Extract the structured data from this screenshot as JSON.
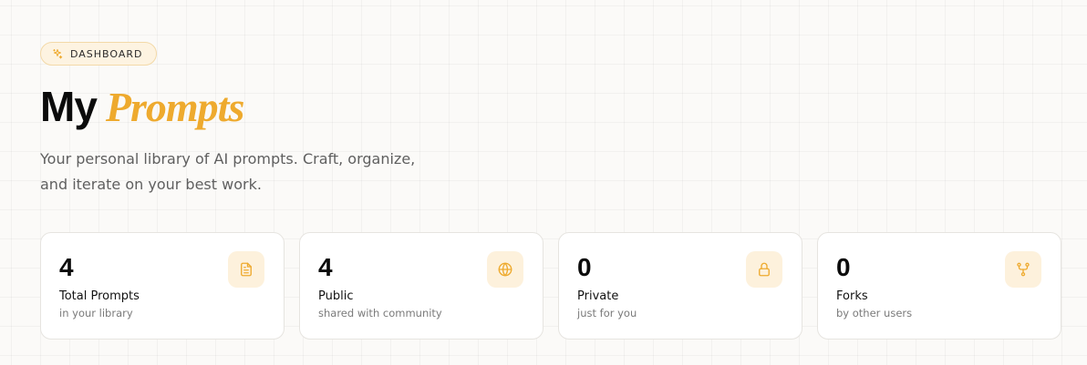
{
  "badge": {
    "label": "DASHBOARD",
    "icon": "sparkles-icon"
  },
  "header": {
    "title_main": "My",
    "title_accent": "Prompts"
  },
  "subtitle": "Your personal library of AI prompts. Craft, organize, and iterate on your best work.",
  "stats": [
    {
      "value": "4",
      "label": "Total Prompts",
      "sublabel": "in your library",
      "icon": "document-icon"
    },
    {
      "value": "4",
      "label": "Public",
      "sublabel": "shared with community",
      "icon": "globe-icon"
    },
    {
      "value": "0",
      "label": "Private",
      "sublabel": "just for you",
      "icon": "lock-icon"
    },
    {
      "value": "0",
      "label": "Forks",
      "sublabel": "by other users",
      "icon": "fork-icon"
    }
  ],
  "colors": {
    "accent": "#eeaa2e",
    "icon_bg": "#fdf1dc",
    "badge_bg": "#fdf3e1",
    "badge_border": "#f3d9a8"
  }
}
